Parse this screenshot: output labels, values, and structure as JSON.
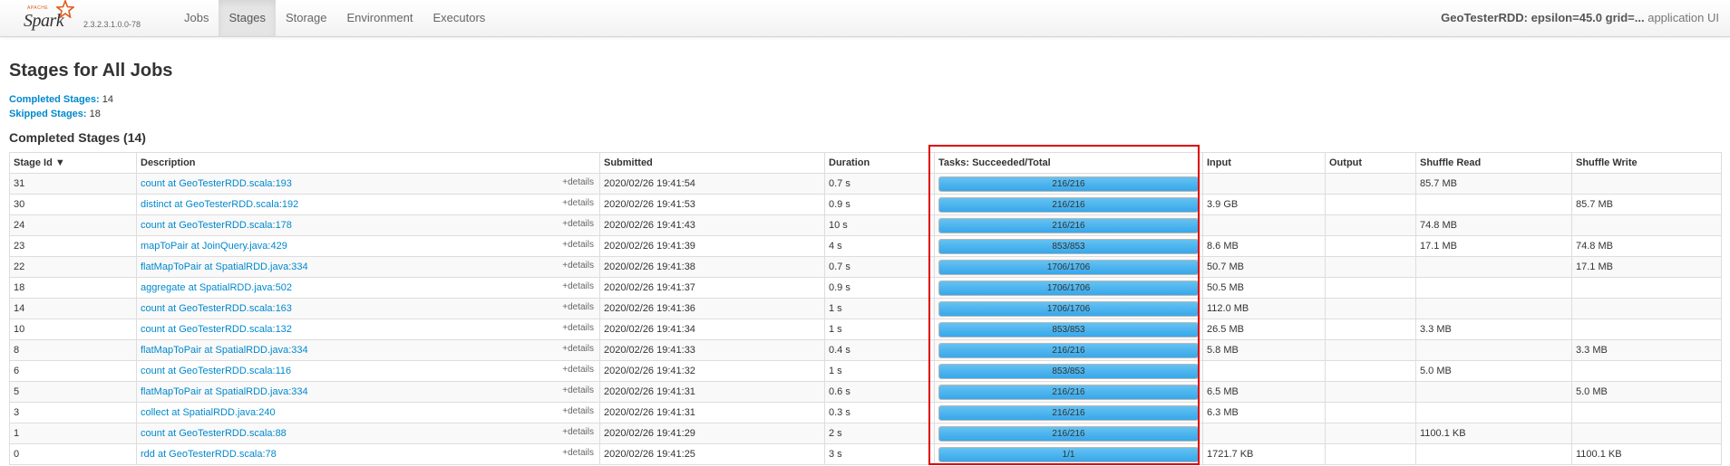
{
  "navbar": {
    "logo_apache": "APACHE",
    "logo_word": "Spark",
    "version": "2.3.2.3.1.0.0-78",
    "tabs": [
      {
        "label": "Jobs",
        "active": false
      },
      {
        "label": "Stages",
        "active": true
      },
      {
        "label": "Storage",
        "active": false
      },
      {
        "label": "Environment",
        "active": false
      },
      {
        "label": "Executors",
        "active": false
      }
    ],
    "app_name_bold": "GeoTesterRDD: epsilon=45.0 grid=...",
    "app_name_suffix": " application UI"
  },
  "page": {
    "title": "Stages for All Jobs",
    "completed_label": "Completed Stages:",
    "completed_count": "14",
    "skipped_label": "Skipped Stages:",
    "skipped_count": "18",
    "section_title": "Completed Stages (14)"
  },
  "table": {
    "headers": [
      "Stage Id ▼",
      "Description",
      "Submitted",
      "Duration",
      "Tasks: Succeeded/Total",
      "Input",
      "Output",
      "Shuffle Read",
      "Shuffle Write"
    ],
    "details_label": "+details",
    "rows": [
      {
        "id": "31",
        "desc": "count at GeoTesterRDD.scala:193",
        "submitted": "2020/02/26 19:41:54",
        "duration": "0.7 s",
        "tasks": "216/216",
        "progress": 1.0,
        "input": "",
        "output": "",
        "shuffle_read": "85.7 MB",
        "shuffle_write": ""
      },
      {
        "id": "30",
        "desc": "distinct at GeoTesterRDD.scala:192",
        "submitted": "2020/02/26 19:41:53",
        "duration": "0.9 s",
        "tasks": "216/216",
        "progress": 1.0,
        "input": "3.9 GB",
        "output": "",
        "shuffle_read": "",
        "shuffle_write": "85.7 MB"
      },
      {
        "id": "24",
        "desc": "count at GeoTesterRDD.scala:178",
        "submitted": "2020/02/26 19:41:43",
        "duration": "10 s",
        "tasks": "216/216",
        "progress": 1.0,
        "input": "",
        "output": "",
        "shuffle_read": "74.8 MB",
        "shuffle_write": ""
      },
      {
        "id": "23",
        "desc": "mapToPair at JoinQuery.java:429",
        "submitted": "2020/02/26 19:41:39",
        "duration": "4 s",
        "tasks": "853/853",
        "progress": 1.0,
        "input": "8.6 MB",
        "output": "",
        "shuffle_read": "17.1 MB",
        "shuffle_write": "74.8 MB"
      },
      {
        "id": "22",
        "desc": "flatMapToPair at SpatialRDD.java:334",
        "submitted": "2020/02/26 19:41:38",
        "duration": "0.7 s",
        "tasks": "1706/1706",
        "progress": 1.0,
        "input": "50.7 MB",
        "output": "",
        "shuffle_read": "",
        "shuffle_write": "17.1 MB"
      },
      {
        "id": "18",
        "desc": "aggregate at SpatialRDD.java:502",
        "submitted": "2020/02/26 19:41:37",
        "duration": "0.9 s",
        "tasks": "1706/1706",
        "progress": 1.0,
        "input": "50.5 MB",
        "output": "",
        "shuffle_read": "",
        "shuffle_write": ""
      },
      {
        "id": "14",
        "desc": "count at GeoTesterRDD.scala:163",
        "submitted": "2020/02/26 19:41:36",
        "duration": "1 s",
        "tasks": "1706/1706",
        "progress": 1.0,
        "input": "112.0 MB",
        "output": "",
        "shuffle_read": "",
        "shuffle_write": ""
      },
      {
        "id": "10",
        "desc": "count at GeoTesterRDD.scala:132",
        "submitted": "2020/02/26 19:41:34",
        "duration": "1 s",
        "tasks": "853/853",
        "progress": 1.0,
        "input": "26.5 MB",
        "output": "",
        "shuffle_read": "3.3 MB",
        "shuffle_write": ""
      },
      {
        "id": "8",
        "desc": "flatMapToPair at SpatialRDD.java:334",
        "submitted": "2020/02/26 19:41:33",
        "duration": "0.4 s",
        "tasks": "216/216",
        "progress": 1.0,
        "input": "5.8 MB",
        "output": "",
        "shuffle_read": "",
        "shuffle_write": "3.3 MB"
      },
      {
        "id": "6",
        "desc": "count at GeoTesterRDD.scala:116",
        "submitted": "2020/02/26 19:41:32",
        "duration": "1 s",
        "tasks": "853/853",
        "progress": 1.0,
        "input": "",
        "output": "",
        "shuffle_read": "5.0 MB",
        "shuffle_write": ""
      },
      {
        "id": "5",
        "desc": "flatMapToPair at SpatialRDD.java:334",
        "submitted": "2020/02/26 19:41:31",
        "duration": "0.6 s",
        "tasks": "216/216",
        "progress": 1.0,
        "input": "6.5 MB",
        "output": "",
        "shuffle_read": "",
        "shuffle_write": "5.0 MB"
      },
      {
        "id": "3",
        "desc": "collect at SpatialRDD.java:240",
        "submitted": "2020/02/26 19:41:31",
        "duration": "0.3 s",
        "tasks": "216/216",
        "progress": 1.0,
        "input": "6.3 MB",
        "output": "",
        "shuffle_read": "",
        "shuffle_write": ""
      },
      {
        "id": "1",
        "desc": "count at GeoTesterRDD.scala:88",
        "submitted": "2020/02/26 19:41:29",
        "duration": "2 s",
        "tasks": "216/216",
        "progress": 1.0,
        "input": "",
        "output": "",
        "shuffle_read": "1100.1 KB",
        "shuffle_write": ""
      },
      {
        "id": "0",
        "desc": "rdd at GeoTesterRDD.scala:78",
        "submitted": "2020/02/26 19:41:25",
        "duration": "3 s",
        "tasks": "1/1",
        "progress": 1.0,
        "input": "1721.7 KB",
        "output": "",
        "shuffle_read": "",
        "shuffle_write": "1100.1 KB"
      }
    ]
  },
  "colors": {
    "link": "#0088cc",
    "progress_fill": "#37a7ea",
    "highlight": "#dd0000",
    "spark_orange": "#e25a1c"
  },
  "icons": {
    "logo": "spark-star-icon"
  }
}
